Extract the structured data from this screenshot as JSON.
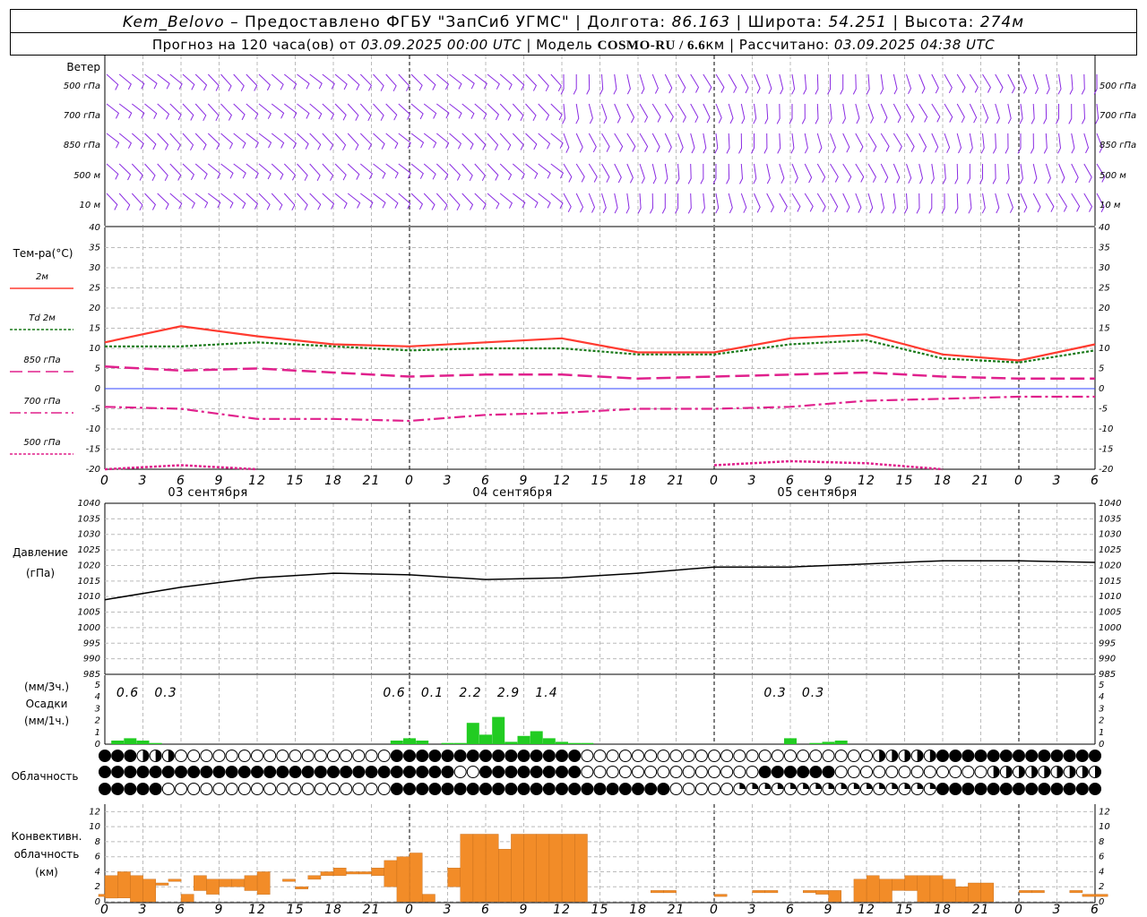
{
  "header": {
    "line1": {
      "station": "Kem_Belovo",
      "provider": " – Предоставлено ФГБУ \"ЗапСиб УГМС\" | Долгота: ",
      "lon": "86.163",
      "lat_label": " | Широта: ",
      "lat": "54.251",
      "alt_label": " | Высота: ",
      "alt": "274м"
    },
    "line2": {
      "prefix": "Прогноз на 120 часа(ов) от ",
      "run": "03.09.2025 00:00 UTC",
      "model_label": " | Модель ",
      "model": "COSMO-RU / 6.6",
      "km": "км",
      "calc_label": " | Рассчитано: ",
      "calc": "03.09.2025 04:38 UTC"
    }
  },
  "wind_panel": {
    "title": "Ветер",
    "levels": [
      "500 гПа",
      "700 гПа",
      "850 гПа",
      "500 м",
      "10   м"
    ]
  },
  "temp_panel": {
    "title": "Тем-ра(°С)",
    "legend": [
      {
        "name": "2м",
        "color": "#ff3b30",
        "dash": ""
      },
      {
        "name": "Td  2м",
        "color": "#1a7a1a",
        "dash": "3,2"
      },
      {
        "name": "850 гПа",
        "color": "#e0208c",
        "dash": "14,6"
      },
      {
        "name": "700 гПа",
        "color": "#e0208c",
        "dash": "12,4,3,4"
      },
      {
        "name": "500 гПа",
        "color": "#e0208c",
        "dash": "3,2"
      }
    ],
    "yticks": [
      40,
      35,
      30,
      25,
      20,
      15,
      10,
      5,
      0,
      -5,
      -10,
      -15,
      -20
    ]
  },
  "pressure_panel": {
    "title1": "Давление",
    "title2": "(гПа)",
    "yticks": [
      1040,
      1035,
      1030,
      1025,
      1020,
      1015,
      1010,
      1005,
      1000,
      995,
      990,
      985
    ]
  },
  "precip_panel": {
    "label1": "(мм/3ч.)",
    "label2": "Осадки",
    "label3": "(мм/1ч.)",
    "yticks": [
      5,
      4,
      3,
      2,
      1,
      0
    ],
    "totals": [
      {
        "hour": 3,
        "value": "0.6"
      },
      {
        "hour": 6,
        "value": "0.3"
      },
      {
        "hour": 24,
        "value": "0.6"
      },
      {
        "hour": 27,
        "value": "0.1"
      },
      {
        "hour": 30,
        "value": "2.2"
      },
      {
        "hour": 33,
        "value": "2.9"
      },
      {
        "hour": 36,
        "value": "1.4"
      },
      {
        "hour": 54,
        "value": "0.3"
      },
      {
        "hour": 57,
        "value": "0.3"
      }
    ]
  },
  "cloud_panel": {
    "title": "Облачность"
  },
  "conv_panel": {
    "label1": "Конвективн.",
    "label2": "облачность",
    "label3": "(км)",
    "yticks": [
      12,
      10,
      8,
      6,
      4,
      2,
      0
    ]
  },
  "xaxis": {
    "hour_labels": [
      "0",
      "3",
      "6",
      "9",
      "12",
      "15",
      "18",
      "21",
      "0",
      "3",
      "6",
      "9",
      "12",
      "15",
      "18",
      "21",
      "0",
      "3",
      "6",
      "9",
      "12",
      "15",
      "18",
      "21",
      "0",
      "3",
      "6"
    ],
    "dates": [
      "03 сентября",
      "04 сентября",
      "05 сентября"
    ]
  },
  "chart_data": {
    "type": "line",
    "x_unit": "hours from 03.09.2025 00:00 UTC",
    "x": [
      0,
      6,
      12,
      18,
      24,
      30,
      36,
      42,
      48,
      54,
      60,
      66,
      72,
      78
    ],
    "series": [
      {
        "name": "2м",
        "values": [
          11.5,
          15.5,
          13,
          11,
          10.5,
          11.5,
          12.5,
          9,
          9,
          12.5,
          13.5,
          8.5,
          7,
          11
        ]
      },
      {
        "name": "Td  2м",
        "values": [
          10.5,
          10.5,
          11.5,
          10.5,
          9.5,
          10,
          10,
          8.5,
          8.5,
          11,
          12,
          7.5,
          6.5,
          9.5
        ]
      },
      {
        "name": "850 гПа",
        "values": [
          5.5,
          4.5,
          5,
          4,
          3,
          3.5,
          3.5,
          2.5,
          3,
          3.5,
          4,
          3,
          2.5,
          2.5
        ]
      },
      {
        "name": "700 гПа",
        "values": [
          -4.5,
          -5,
          -7.5,
          -7.5,
          -8,
          -6.5,
          -6,
          -5,
          -5,
          -4.5,
          -3,
          -2.5,
          -2,
          -2
        ]
      },
      {
        "name": "500 гПа",
        "values": [
          -20,
          -19,
          -20,
          null,
          null,
          null,
          null,
          null,
          -19,
          -18,
          -18.5,
          -20,
          null,
          null
        ]
      },
      {
        "name": "Давление",
        "values": [
          1009,
          1013,
          1016,
          1017.5,
          1017,
          1015.5,
          1016,
          1017.5,
          1019.5,
          1019.5,
          1020.5,
          1021.5,
          1021.5,
          1021
        ]
      }
    ],
    "precip_1h": {
      "x": [
        1,
        2,
        3,
        4,
        23,
        24,
        25,
        27,
        28,
        29,
        30,
        31,
        32,
        33,
        34,
        35,
        36,
        37,
        38,
        54,
        56,
        57,
        58
      ],
      "values": [
        0.3,
        0.5,
        0.3,
        0.1,
        0.3,
        0.5,
        0.3,
        0.1,
        0.1,
        1.8,
        0.8,
        2.3,
        0.2,
        0.7,
        1.1,
        0.5,
        0.2,
        0.1,
        0.1,
        0.5,
        0.1,
        0.2,
        0.3
      ]
    },
    "conv_cloud_km": {
      "x": [
        0,
        0.5,
        1.5,
        2.5,
        3.5,
        4.5,
        5.5,
        6.5,
        7.5,
        8.5,
        9.5,
        10.5,
        11.5,
        12.5,
        13.5,
        14.5,
        15.5,
        16.5,
        17.5,
        18.5,
        19.5,
        20.5,
        21.5,
        22.5,
        23.5,
        24.5,
        25.5,
        26.5,
        27.5,
        28.5,
        29.5,
        30.5,
        31.5,
        32.5,
        33.5,
        34.5,
        35.5,
        36.5,
        37.5,
        38.5,
        39.5,
        40.5,
        41.5,
        42.5,
        43.5,
        44.5,
        45.5,
        46.5,
        47.5,
        48.5,
        49.5,
        50.5,
        51.5,
        52.5,
        53.5,
        54.5,
        55.5,
        56.5,
        57.5,
        58.5,
        59.5,
        60.5,
        61.5,
        62.5,
        63.5,
        64.5,
        65.5,
        66.5,
        67.5,
        68.5,
        69.5,
        70.5,
        71.5,
        72.5,
        73.5,
        74.5,
        75.5,
        76.5,
        77.5,
        78.5
      ],
      "bottom": [
        1,
        0.5,
        0.5,
        0,
        0,
        2.5,
        3,
        0,
        1.5,
        1,
        2,
        2,
        1.5,
        1,
        0,
        3,
        2,
        3,
        3.5,
        3.5,
        4,
        4,
        3.5,
        2,
        0,
        0,
        0,
        0,
        2,
        0,
        0,
        0,
        0,
        0,
        0,
        0,
        0,
        0,
        0,
        0,
        0,
        0,
        0,
        0,
        1.5,
        1.5,
        0,
        0,
        0,
        1,
        0,
        0,
        1.5,
        1.5,
        0,
        0,
        1.5,
        1,
        0,
        0,
        0,
        0,
        0,
        1.5,
        1.5,
        0,
        0,
        0,
        0,
        0,
        0,
        0,
        0,
        1.5,
        1.5,
        0,
        0,
        1.5,
        1,
        1
      ],
      "top": [
        1,
        3.5,
        4,
        3.5,
        3,
        2.5,
        3,
        1,
        3.5,
        3,
        3,
        3,
        3.5,
        4,
        0,
        3,
        2,
        3.5,
        4,
        4.5,
        4,
        4,
        4.5,
        5.5,
        6,
        6.5,
        1,
        0,
        4.5,
        9,
        9,
        9,
        7,
        9,
        9,
        9,
        9,
        9,
        9,
        0,
        0,
        0,
        0,
        0,
        1.5,
        1.5,
        0,
        0,
        0,
        1,
        0,
        0,
        1.5,
        1.5,
        0,
        0,
        1.5,
        1.5,
        1.5,
        0,
        3,
        3.5,
        3,
        3,
        3.5,
        3.5,
        3.5,
        3,
        2,
        2.5,
        2.5,
        0,
        0,
        1.5,
        1.5,
        0,
        0,
        1.5,
        1,
        1
      ]
    }
  }
}
